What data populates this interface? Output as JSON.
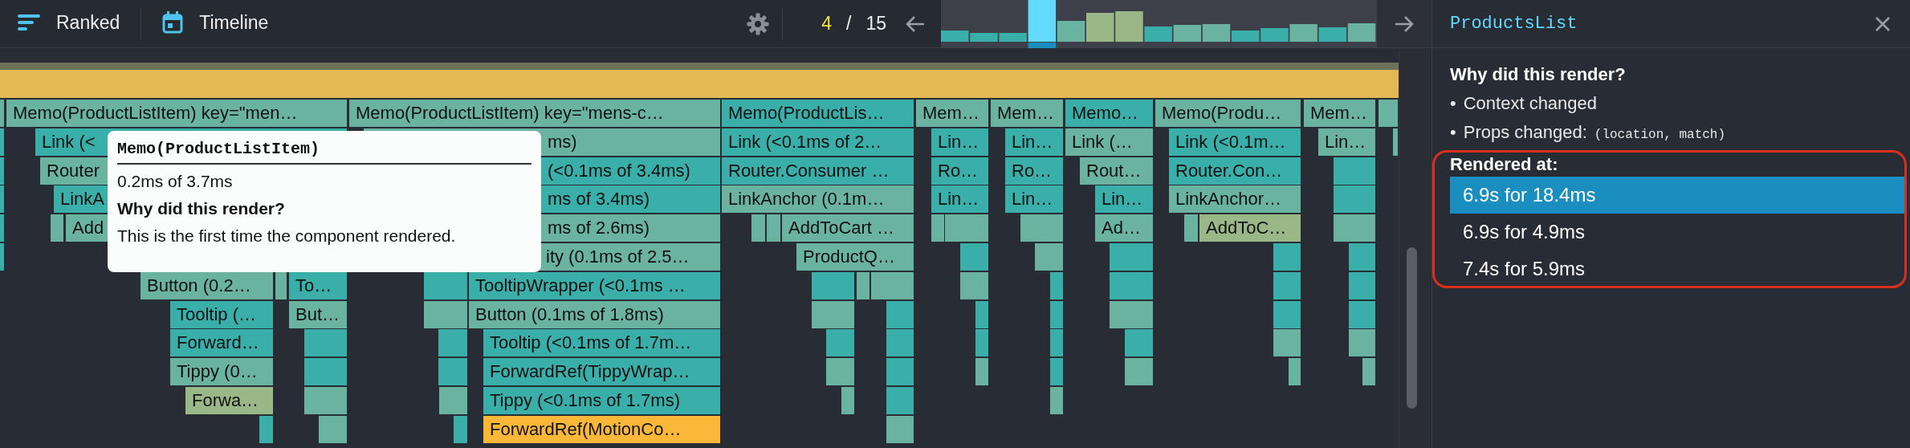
{
  "toolbar": {
    "tabs": [
      {
        "label": "Ranked",
        "selected": false
      },
      {
        "label": "Timeline",
        "selected": false
      }
    ],
    "commit_index": "4",
    "commit_separator": "/",
    "commit_total": "15"
  },
  "flame_graph": {
    "bars": [
      {
        "label": "Memo(ProductListItem) key=\"men…",
        "color": "#6ab3a1"
      },
      {
        "label": "Memo(ProductListItem) key=\"mens-c…",
        "color": "#6ab3a1"
      },
      {
        "label": "Memo(ProductLis…",
        "color": "#3aafa9"
      },
      {
        "label": "Mem…",
        "color": "#6ab3a1"
      },
      {
        "label": "Mem…",
        "color": "#6ab3a1"
      },
      {
        "label": "Memo…",
        "color": "#3aafa9"
      },
      {
        "label": "Memo(Produ…",
        "color": "#6ab3a1"
      },
      {
        "label": "Mem…",
        "color": "#6ab3a1"
      },
      {
        "label": "Link (<",
        "color": "#3aafa9"
      },
      {
        "label": "ms)",
        "color": "#6ab3a1"
      },
      {
        "label": "Link (<0.1ms of 2…",
        "color": "#3aafa9"
      },
      {
        "label": "Lin…",
        "color": "#3aafa9"
      },
      {
        "label": "Lin…",
        "color": "#3aafa9"
      },
      {
        "label": "Link (…",
        "color": "#6ab3a1"
      },
      {
        "label": "Link (<0.1m…",
        "color": "#3aafa9"
      },
      {
        "label": "Lin…",
        "color": "#6ab3a1"
      },
      {
        "label": "Router",
        "color": "#6ab3a1"
      },
      {
        "label": "(<0.1ms of 3.4ms)",
        "color": "#3aafa9"
      },
      {
        "label": "Router.Consumer …",
        "color": "#3aafa9"
      },
      {
        "label": "Ro…",
        "color": "#3aafa9"
      },
      {
        "label": "Ro…",
        "color": "#3aafa9"
      },
      {
        "label": "Rout…",
        "color": "#6ab3a1"
      },
      {
        "label": "Router.Con…",
        "color": "#3aafa9"
      },
      {
        "label": "LinkA",
        "color": "#3aafa9"
      },
      {
        "label": "ms of 3.4ms)",
        "color": "#3aafa9"
      },
      {
        "label": "LinkAnchor (0.1m…",
        "color": "#6ab3a1"
      },
      {
        "label": "Lin…",
        "color": "#3aafa9"
      },
      {
        "label": "Lin…",
        "color": "#3aafa9"
      },
      {
        "label": "Lin…",
        "color": "#3aafa9"
      },
      {
        "label": "LinkAnchor…",
        "color": "#6ab3a1"
      },
      {
        "label": "Add",
        "color": "#6ab3a1"
      },
      {
        "label": "ms of 2.6ms)",
        "color": "#6ab3a1"
      },
      {
        "label": "AddToCart …",
        "color": "#6ab3a1"
      },
      {
        "label": "Ad…",
        "color": "#6ab3a1"
      },
      {
        "label": "AddToC…",
        "color": "#9ab887"
      },
      {
        "label": "ity (0.1ms of 2.5…",
        "color": "#6ab3a1"
      },
      {
        "label": "ProductQ…",
        "color": "#6ab3a1"
      },
      {
        "label": "Button (0.2…",
        "color": "#6ab3a1"
      },
      {
        "label": "To…",
        "color": "#3aafa9"
      },
      {
        "label": "TooltipWrapper (<0.1ms …",
        "color": "#3aafa9"
      },
      {
        "label": "Tooltip (…",
        "color": "#3aafa9"
      },
      {
        "label": "But…",
        "color": "#6ab3a1"
      },
      {
        "label": "Button (0.1ms of 1.8ms)",
        "color": "#6ab3a1"
      },
      {
        "label": "Forward…",
        "color": "#3aafa9"
      },
      {
        "label": "Tooltip (<0.1ms of 1.7m…",
        "color": "#3aafa9"
      },
      {
        "label": "Tippy (0…",
        "color": "#6ab3a1"
      },
      {
        "label": "ForwardRef(TippyWrap…",
        "color": "#3aafa9"
      },
      {
        "label": "Forwa…",
        "color": "#9ab887"
      },
      {
        "label": "Tippy (<0.1ms of 1.7ms)",
        "color": "#3aafa9"
      },
      {
        "label": "ForwardRef(MotionCo…",
        "color": "#fbb838"
      }
    ],
    "tooltip": {
      "title": "Memo(ProductListItem)",
      "duration": "0.2ms of 3.7ms",
      "heading": "Why did this render?",
      "text": "This is the first time the component rendered."
    }
  },
  "side_panel": {
    "title": "ProductsList",
    "why_heading": "Why did this render?",
    "reasons": [
      {
        "bullet": "•",
        "text": "Context changed"
      },
      {
        "bullet": "•",
        "text": "Props changed:",
        "code": "(location, match)"
      }
    ],
    "rendered_heading": "Rendered at:",
    "renders": [
      {
        "label": "6.9s for 18.4ms",
        "selected": true
      },
      {
        "label": "6.9s for 4.9ms",
        "selected": false
      },
      {
        "label": "7.4s for 5.9ms",
        "selected": false
      }
    ]
  }
}
